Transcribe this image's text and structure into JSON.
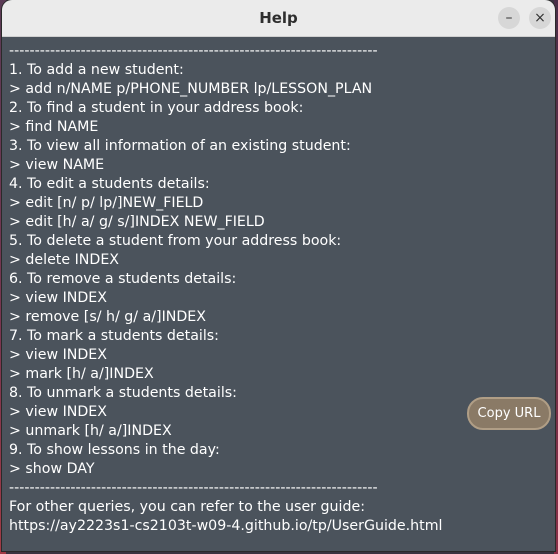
{
  "window": {
    "title": "Help",
    "minimize_glyph": "–",
    "close_glyph": "×"
  },
  "help_lines": [
    "------------------------------------------------------------------------",
    "1. To add a new student:",
    "> add n/NAME p/PHONE_NUMBER lp/LESSON_PLAN",
    "2. To find a student in your address book:",
    "> find NAME",
    "3. To view all information of an existing student:",
    "> view NAME",
    "4. To edit a students details:",
    "> edit [n/ p/ lp/]NEW_FIELD",
    "> edit [h/ a/ g/ s/]INDEX NEW_FIELD",
    "5. To delete a student from your address book:",
    "> delete INDEX",
    "6. To remove a students details:",
    "> view INDEX",
    "> remove [s/ h/ g/ a/]INDEX",
    "7. To mark a students details:",
    "> view INDEX",
    "> mark [h/ a/]INDEX",
    "8. To unmark a students details:",
    "> view INDEX",
    "> unmark [h/ a/]INDEX",
    "9. To show lessons in the day:",
    "> show DAY",
    "------------------------------------------------------------------------",
    "For other queries, you can refer to the user guide:",
    "https://ay2223s1-cs2103t-w09-4.github.io/tp/UserGuide.html"
  ],
  "copy_button": {
    "label": "Copy URL"
  },
  "colors": {
    "window_background": "#4b535c",
    "text": "#ffffff",
    "button_background": "#8a7a66"
  }
}
